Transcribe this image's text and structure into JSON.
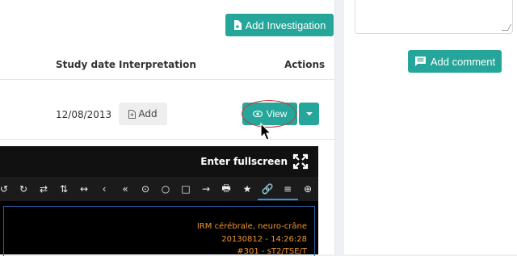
{
  "toolbar_top": {
    "add_investigation_label": "Add Investigation",
    "add_investigation_icon": "file-plus-icon"
  },
  "table": {
    "headers": {
      "study_date": "Study date",
      "interpretation": "Interpretation",
      "actions": "Actions"
    },
    "row": {
      "study_date": "12/08/2013",
      "interpretation_button": "Add",
      "view_button": "View"
    }
  },
  "sidebar": {
    "comment_placeholder": "",
    "add_comment_label": "Add comment",
    "add_comment_icon": "comment-icon"
  },
  "viewer": {
    "fullscreen_label": "Enter fullscreen",
    "tools": [
      "↻",
      "⇄",
      "⇅",
      "↔",
      "‹",
      "«",
      "⊙",
      "○",
      "□",
      "→",
      "🖶",
      "★",
      "🔗",
      "≡",
      "⊕"
    ],
    "overlay": {
      "line1": "IRM cérébrale, neuro-crâne",
      "line2": "20130812 - 14:26:28",
      "line3": "#301 - sT2/TSE/T"
    }
  },
  "colors": {
    "accent": "#26a69a",
    "highlight": "#d32f2f",
    "overlay_text": "#f0962c",
    "tool_active": "#3a8ee6"
  }
}
